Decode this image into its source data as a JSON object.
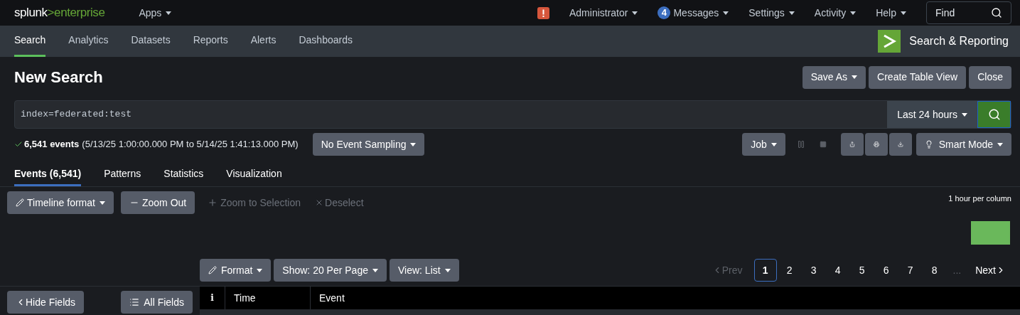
{
  "top_bar": {
    "logo": {
      "brand": "splunk",
      "product": ">enterprise"
    },
    "apps_menu": "Apps",
    "menus": [
      {
        "label": "Administrator",
        "kind": "alert"
      },
      {
        "label": "Messages",
        "kind": "count",
        "badge": "4"
      },
      {
        "label": "Settings"
      },
      {
        "label": "Activity"
      },
      {
        "label": "Help"
      }
    ],
    "find": {
      "placeholder": "Find"
    }
  },
  "app_bar": {
    "tabs": [
      {
        "label": "Search",
        "selected": true
      },
      {
        "label": "Analytics",
        "selected": false
      },
      {
        "label": "Datasets",
        "selected": false
      },
      {
        "label": "Reports",
        "selected": false
      },
      {
        "label": "Alerts",
        "selected": false
      },
      {
        "label": "Dashboards",
        "selected": false
      }
    ],
    "app_name": "Search & Reporting"
  },
  "page": {
    "title": "New Search",
    "actions": [
      {
        "label": "Save As",
        "dropdown": true
      },
      {
        "label": "Create Table View",
        "dropdown": false
      },
      {
        "label": "Close",
        "dropdown": false
      }
    ]
  },
  "search": {
    "query": "index=federated:test",
    "time_range": "Last 24 hours"
  },
  "status": {
    "count": "6,541 events",
    "range": "(5/13/25 1:00:00.000 PM to 5/14/25 1:41:13.000 PM)",
    "sampling": "No Event Sampling",
    "job": "Job",
    "pause_disabled": true,
    "stop_disabled": true,
    "mode": "Smart Mode"
  },
  "result_tabs": [
    {
      "label": "Events (6,541)",
      "selected": true
    },
    {
      "label": "Patterns",
      "selected": false
    },
    {
      "label": "Statistics",
      "selected": false
    },
    {
      "label": "Visualization",
      "selected": false
    }
  ],
  "timeline": {
    "buttons": [
      {
        "label": "Timeline format",
        "kind": "format",
        "disabled": false
      },
      {
        "label": "Zoom Out",
        "kind": "minus",
        "disabled": false
      },
      {
        "label": "Zoom to Selection",
        "kind": "plus",
        "disabled": true
      },
      {
        "label": "Deselect",
        "kind": "cross",
        "disabled": true
      }
    ],
    "scale": "1 hour per column"
  },
  "results_toolbar": {
    "buttons": [
      "Format",
      "Show: 20 Per Page",
      "View: List"
    ],
    "prev": {
      "label": "Prev",
      "disabled": true
    },
    "pages": [
      {
        "label": "1",
        "selected": true
      },
      {
        "label": "2",
        "selected": false
      },
      {
        "label": "3",
        "selected": false
      },
      {
        "label": "4",
        "selected": false
      },
      {
        "label": "5",
        "selected": false
      },
      {
        "label": "6",
        "selected": false
      },
      {
        "label": "7",
        "selected": false
      },
      {
        "label": "8",
        "selected": false
      }
    ],
    "ellipsis": "...",
    "next": "Next"
  },
  "fields_panel": {
    "hide": "Hide Fields",
    "all": "All Fields"
  },
  "table": {
    "columns": [
      "i",
      "Time",
      "Event"
    ]
  }
}
